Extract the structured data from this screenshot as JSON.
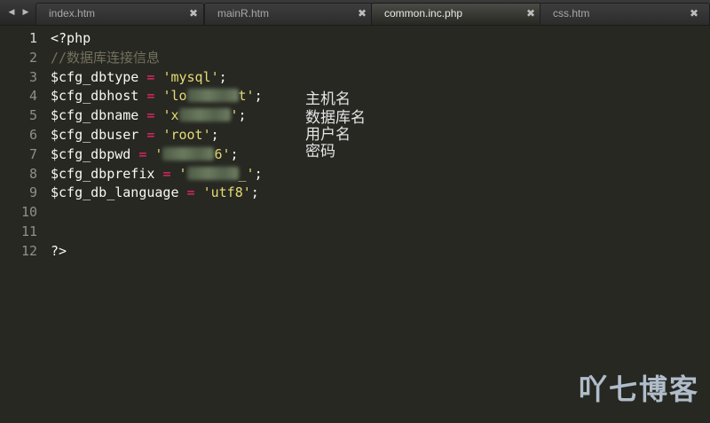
{
  "tabs": [
    {
      "label": "index.htm",
      "close": "✖",
      "active": false
    },
    {
      "label": "mainR.htm",
      "close": "✖",
      "active": false
    },
    {
      "label": "common.inc.php",
      "close": "✖",
      "active": true
    },
    {
      "label": "css.htm",
      "close": "✖",
      "active": false
    }
  ],
  "nav": {
    "left": "◀",
    "right": "▶"
  },
  "line_numbers": [
    "1",
    "2",
    "3",
    "4",
    "5",
    "6",
    "7",
    "8",
    "9",
    "10",
    "11",
    "12"
  ],
  "code": {
    "l1": "<?php",
    "l2_comment": "//数据库连接信息",
    "l3_var": "$cfg_dbtype",
    "l3_eq": "=",
    "l3_val": "'mysql'",
    "l3_end": ";",
    "l4_var": "$cfg_dbhost",
    "l4_eq": "=",
    "l4_val_a": "'lo",
    "l4_val_b": "t'",
    "l4_end": ";",
    "l5_var": "$cfg_dbname",
    "l5_eq": "=",
    "l5_val_a": "'x",
    "l5_val_b": "'",
    "l5_end": ";",
    "l6_var": "$cfg_dbuser",
    "l6_eq": "=",
    "l6_val": "'root'",
    "l6_end": ";",
    "l7_var": "$cfg_dbpwd",
    "l7_eq": "=",
    "l7_val_a": "'",
    "l7_val_b": "6'",
    "l7_end": ";",
    "l8_var": "$cfg_dbprefix",
    "l8_eq": "=",
    "l8_val_a": "'",
    "l8_val_b": "_'",
    "l8_end": ";",
    "l9_var": "$cfg_db_language",
    "l9_eq": "=",
    "l9_val": "'utf8'",
    "l9_end": ";",
    "l12": "?>"
  },
  "annotations": {
    "host": "主机名",
    "dbname": "数据库名",
    "user": "用户名",
    "pwd": "密码"
  },
  "watermark": "吖七博客",
  "colors": {
    "background": "#272822",
    "string": "#e6db74",
    "operator": "#f92672",
    "comment": "#75715e",
    "text": "#f8f8f2"
  }
}
